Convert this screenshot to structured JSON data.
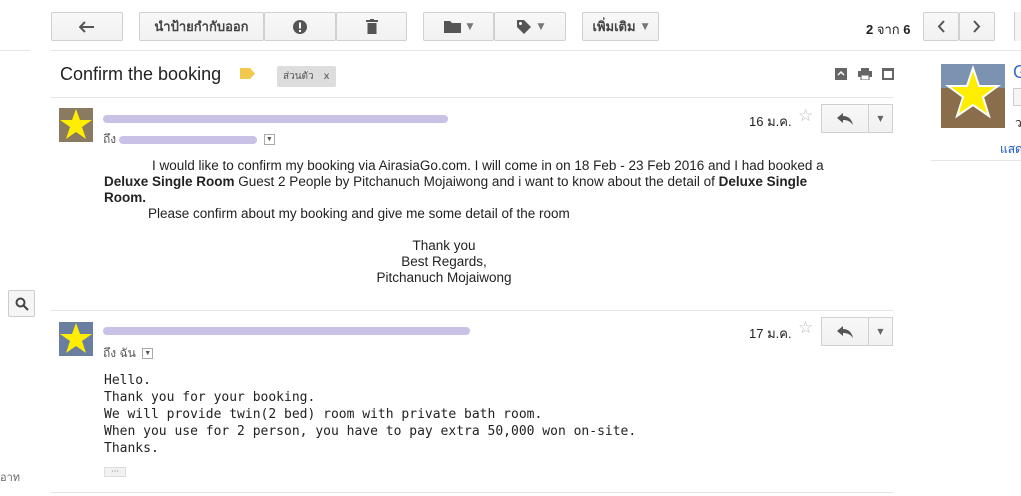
{
  "toolbar": {
    "back_icon": "arrow-left-icon",
    "archive_label": "นำป้ายกำกับออก",
    "spam_icon": "exclamation-icon",
    "delete_icon": "trash-icon",
    "move_icon": "folder-icon",
    "labels_icon": "tag-icon",
    "more_label": "เพิ่มเติม",
    "pagination": {
      "current": "2",
      "of_word": "จาก",
      "total": "6"
    }
  },
  "thread": {
    "subject": "Confirm the booking",
    "label_chip": "ส่วนตัว",
    "label_remove": "x"
  },
  "messages": [
    {
      "date": "16 ม.ค.",
      "to_prefix": "ถึง",
      "body": {
        "line1": "I would like to confirm my booking via AirasiaGo.com. I will come in on 18 Feb - 23 Feb 2016 and I had booked a",
        "room1": "Deluxe Single Room",
        "line2_mid": " Guest 2 People by Pitchanuch Mojaiwong and i want to know about the detail of ",
        "room2a": "Deluxe Single",
        "room2b": "Room.",
        "line3": "Please confirm about my booking and give me some detail of the room",
        "sig1": "Thank you",
        "sig2": "Best Regards,",
        "sig3": "Pitchanuch Mojaiwong"
      }
    },
    {
      "date": "17 ม.ค.",
      "to_line": "ถึง ฉัน",
      "body": {
        "l1": "Hello.",
        "l2": "Thank you for your booking.",
        "l3": "We will provide twin(2 bed) room with private bath room.",
        "l4": "When you use for 2 person, you have to pay extra 50,000 won on-site.",
        "l5": "Thanks."
      },
      "ellipsis": "···"
    }
  ],
  "side": {
    "link_text": "แสด",
    "bottom_text": "อาท",
    "g_letter": "G",
    "t_letter": "ว"
  }
}
